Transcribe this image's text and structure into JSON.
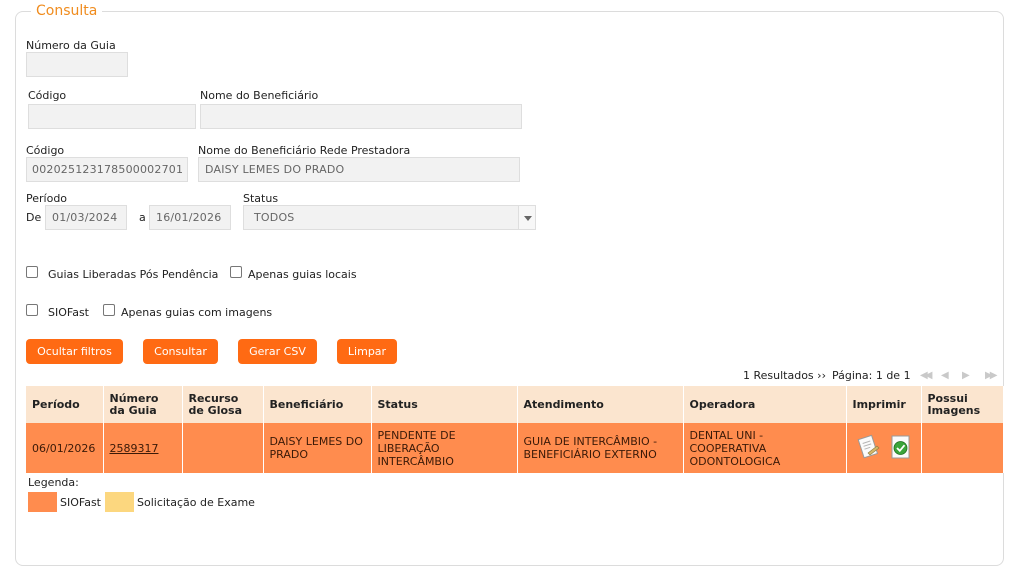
{
  "section": {
    "title": "Consulta"
  },
  "form": {
    "numero_guia": {
      "label": "Número da Guia",
      "value": ""
    },
    "codigo1": {
      "label": "Código",
      "value": ""
    },
    "nome_beneficiario": {
      "label": "Nome do Beneficiário",
      "value": ""
    },
    "codigo2": {
      "label": "Código",
      "value": "00202512317850000270​1"
    },
    "nome_rede": {
      "label": "Nome do Beneficiário Rede Prestadora",
      "value": "DAISY LEMES DO PRADO"
    },
    "periodo": {
      "label": "Período",
      "de": "De",
      "a": "a",
      "start": "01/03/2024",
      "end": "16/01/2026"
    },
    "status": {
      "label": "Status",
      "value": "TODOS"
    },
    "checkboxes": {
      "liberadas": "Guias Liberadas Pós Pendência",
      "locais": "Apenas guias locais",
      "siofast": "SIOFast",
      "imagens": "Apenas guias com imagens"
    }
  },
  "buttons": {
    "ocultar": "Ocultar filtros",
    "consultar": "Consultar",
    "csv": "Gerar CSV",
    "limpar": "Limpar"
  },
  "pager": {
    "results": "1 Resultados ››",
    "page": "Página: 1 de 1"
  },
  "table": {
    "headers": {
      "periodo": "Período",
      "numero": "Número da Guia",
      "recurso": "Recurso de Glosa",
      "beneficiario": "Beneficiário",
      "status": "Status",
      "atendimento": "Atendimento",
      "operadora": "Operadora",
      "imprimir": "Imprimir",
      "imagens": "Possui Imagens"
    },
    "rows": [
      {
        "periodo": "06/01/2026",
        "numero": "2589317",
        "recurso": "",
        "beneficiario": "DAISY LEMES DO PRADO",
        "status": "PENDENTE DE LIBERAÇÃO INTERCÂMBIO",
        "atendimento": "GUIA DE INTERCÂMBIO - BENEFICIÁRIO EXTERNO",
        "operadora": "DENTAL UNI - COOPERATIVA ODONTOLOGICA",
        "imagens": ""
      }
    ]
  },
  "legend": {
    "title": "Legenda:",
    "siofast": "SIOFast",
    "exame": "Solicitação de Exame",
    "colors": {
      "siofast": "#ff8c4e",
      "exame": "#fcd77f"
    }
  },
  "icons": {
    "print": "document-icon",
    "print_ok": "document-check-icon"
  },
  "colors": {
    "accent": "#ff6a13",
    "title": "#f08c1e",
    "header_bg": "#fbe5cf",
    "row_bg": "#ff8c4e"
  }
}
